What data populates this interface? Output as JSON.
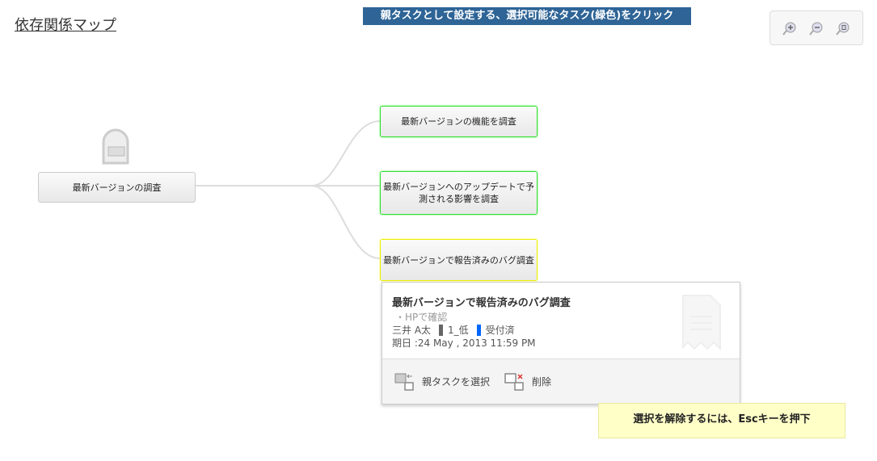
{
  "header": {
    "title": "依存関係マップ",
    "banner": "親タスクとして設定する、選択可能なタスク(緑色)をクリック"
  },
  "zoom": {
    "in": "zoom-in-icon",
    "out": "zoom-out-icon",
    "fit": "zoom-fit-icon"
  },
  "root": {
    "label": "最新バージョンの調査"
  },
  "children": [
    {
      "label": "最新バージョンの機能を調査",
      "color": "#33dd33"
    },
    {
      "label": "最新バージョンへのアップデートで予測される影響を調査",
      "color": "#33dd33"
    },
    {
      "label": "最新バージョンで報告済みのバグ調査",
      "color": "#eeee00"
    }
  ],
  "popup": {
    "title": "最新バージョンで報告済みのバグ調査",
    "description": "・HPで確認",
    "assignee": "三井 A太",
    "priority": "1_低",
    "status": "受付済",
    "due": "期日 :24 May , 2013 11:59 PM",
    "select_parent": "親タスクを選択",
    "delete": "削除"
  },
  "hint": "選択を解除するには、Escキーを押下"
}
